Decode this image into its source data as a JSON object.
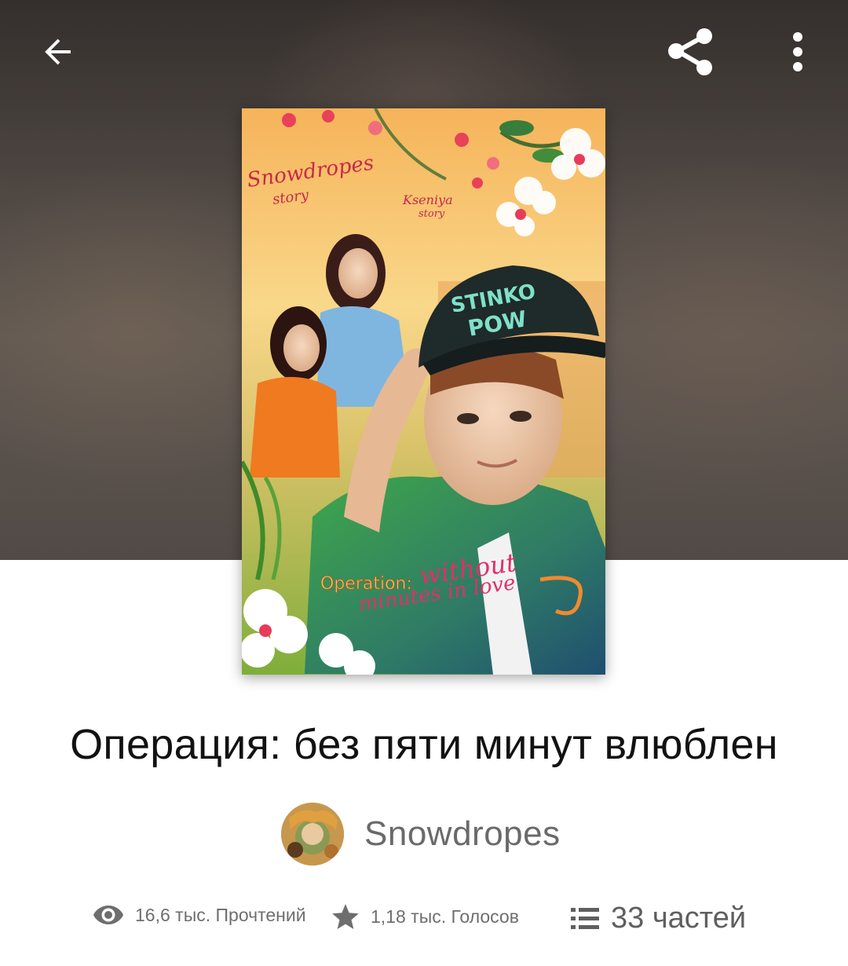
{
  "toolbar": {
    "back_icon": "arrow-left-icon",
    "share_icon": "share-icon",
    "more_icon": "more-vertical-icon"
  },
  "cover": {
    "tag_story": "Snowdropes story",
    "tag_author": "Kseniya story",
    "cap_text": "STINKO POW",
    "title_line1": "Operation: without",
    "title_line2": "minutes in love"
  },
  "story": {
    "title": "Операция: без пяти минут влюблен",
    "author": "Snowdropes"
  },
  "stats": {
    "reads_icon": "eye-icon",
    "reads": "16,6 тыс. Прочтений",
    "votes_icon": "star-icon",
    "votes": "1,18 тыс. Голосов",
    "parts_icon": "list-icon",
    "parts": "33 частей"
  },
  "colors": {
    "header_overlay": "#4f4744",
    "title_text": "#121212",
    "meta_text": "#6e6e6e",
    "background": "#ffffff"
  }
}
